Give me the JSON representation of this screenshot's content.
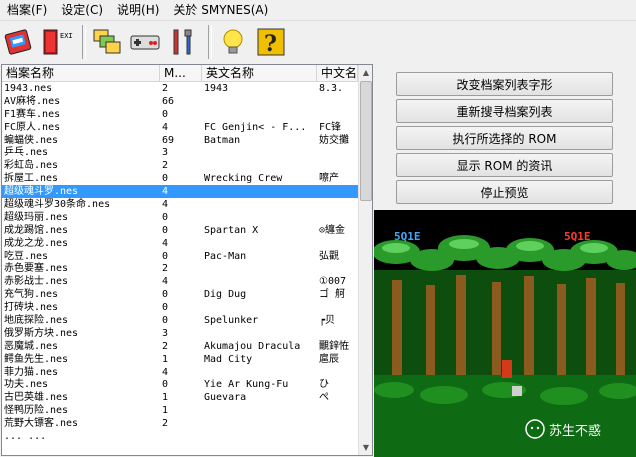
{
  "menu": [
    {
      "label": "档案(F)"
    },
    {
      "label": "设定(C)"
    },
    {
      "label": "说明(H)"
    },
    {
      "label": "关於 SMYNES(A)"
    }
  ],
  "toolbar": {
    "exit_label": "EXIT"
  },
  "list": {
    "columns": [
      {
        "label": "档案名称"
      },
      {
        "label": "M..."
      },
      {
        "label": "英文名称"
      },
      {
        "label": "中文名"
      }
    ],
    "rows": [
      {
        "file": "1943.nes",
        "m": "2",
        "en": "1943",
        "cn": "8.3."
      },
      {
        "file": "AV麻将.nes",
        "m": "66",
        "en": "",
        "cn": ""
      },
      {
        "file": "F1赛车.nes",
        "m": "0",
        "en": "",
        "cn": ""
      },
      {
        "file": "FC原人.nes",
        "m": "4",
        "en": "FC Genjin< - F...",
        "cn": "FC锋"
      },
      {
        "file": "蝙蝠侠.nes",
        "m": "69",
        "en": "Batman",
        "cn": "妨交攤"
      },
      {
        "file": "乒乓.nes",
        "m": "3",
        "en": "",
        "cn": ""
      },
      {
        "file": "彩虹岛.nes",
        "m": "2",
        "en": "",
        "cn": ""
      },
      {
        "file": "拆屋工.nes",
        "m": "0",
        "en": "Wrecking Crew",
        "cn": "嚓产"
      },
      {
        "file": "超级魂斗罗.nes",
        "m": "4",
        "en": "",
        "cn": ""
      },
      {
        "file": "超级魂斗罗30条命.nes",
        "m": "4",
        "en": "",
        "cn": ""
      },
      {
        "file": "超级玛丽.nes",
        "m": "0",
        "en": "",
        "cn": ""
      },
      {
        "file": "成龙踢馆.nes",
        "m": "0",
        "en": "Spartan X",
        "cn": "⊙纏金"
      },
      {
        "file": "成龙之龙.nes",
        "m": "4",
        "en": "",
        "cn": ""
      },
      {
        "file": "吃豆.nes",
        "m": "0",
        "en": "Pac-Man",
        "cn": "弘觀"
      },
      {
        "file": "赤色要塞.nes",
        "m": "2",
        "en": "",
        "cn": ""
      },
      {
        "file": "赤影战士.nes",
        "m": "4",
        "en": "",
        "cn": "①007"
      },
      {
        "file": "充气狗.nes",
        "m": "0",
        "en": "Dig Dug",
        "cn": "ゴ 舸"
      },
      {
        "file": "打砖块.nes",
        "m": "0",
        "en": "",
        "cn": ""
      },
      {
        "file": "地底探险.nes",
        "m": "0",
        "en": "Spelunker",
        "cn": "┍贝"
      },
      {
        "file": "俄罗斯方块.nes",
        "m": "3",
        "en": "",
        "cn": ""
      },
      {
        "file": "恶魔城.nes",
        "m": "2",
        "en": "Akumajou Dracula",
        "cn": "覼鋅恠"
      },
      {
        "file": "鳄鱼先生.nes",
        "m": "1",
        "en": "Mad City",
        "cn": "扈辰"
      },
      {
        "file": "菲力猫.nes",
        "m": "4",
        "en": "",
        "cn": ""
      },
      {
        "file": "功夫.nes",
        "m": "0",
        "en": "Yie Ar Kung-Fu",
        "cn": "ひ"
      },
      {
        "file": "古巴英雄.nes",
        "m": "1",
        "en": "Guevara",
        "cn": "ぺ"
      },
      {
        "file": "怪鸭历险.nes",
        "m": "1",
        "en": "",
        "cn": ""
      },
      {
        "file": "荒野大镖客.nes",
        "m": "2",
        "en": "",
        "cn": ""
      },
      {
        "file": "... ...",
        "m": "",
        "en": "",
        "cn": ""
      }
    ],
    "selected_index": 8
  },
  "buttons": [
    {
      "label": "改变档案列表字形"
    },
    {
      "label": "重新搜寻档案列表"
    },
    {
      "label": "执行所选择的 ROM"
    },
    {
      "label": "显示 ROM 的资讯"
    },
    {
      "label": "停止预览"
    }
  ],
  "preview": {
    "hud_left": "5Q1E",
    "hud_right": "5Q1E"
  },
  "watermark": {
    "text": "苏生不惑"
  }
}
